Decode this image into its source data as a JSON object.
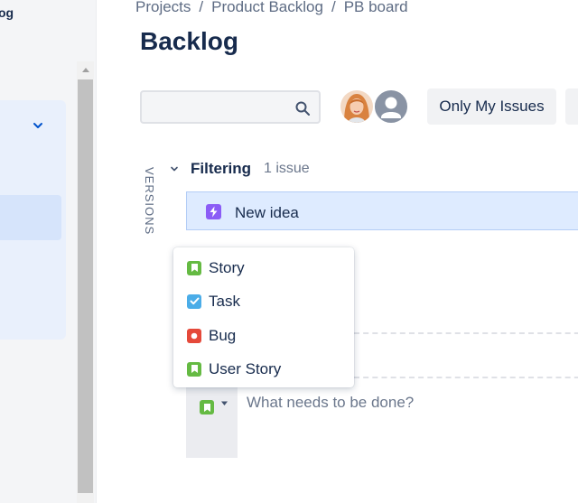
{
  "sidebar": {
    "title": "og"
  },
  "breadcrumb": [
    "Projects",
    "Product Backlog",
    "PB board"
  ],
  "breadcrumb_separator": "/",
  "page": {
    "title": "Backlog"
  },
  "search": {
    "placeholder": "",
    "value": ""
  },
  "toolbar": {
    "only_my_issues_label": "Only My Issues"
  },
  "versions_label": "VERSIONS",
  "sprint": {
    "name": "Filtering",
    "count": "1 issue"
  },
  "issue": {
    "title": "New idea",
    "type_icon": "lightning-icon"
  },
  "create": {
    "placeholder": "What needs to be done?"
  },
  "issue_types": [
    {
      "label": "Story",
      "icon": "bookmark-icon",
      "color": "#65ba43"
    },
    {
      "label": "Task",
      "icon": "checkbox-icon",
      "color": "#4bade8"
    },
    {
      "label": "Bug",
      "icon": "bug-dot-icon",
      "color": "#e5493a"
    },
    {
      "label": "User Story",
      "icon": "bookmark-icon",
      "color": "#65ba43"
    }
  ],
  "colors": {
    "accent": "#0052cc",
    "selected_row": "#deebff",
    "idea_purple": "#8b5cf6"
  }
}
